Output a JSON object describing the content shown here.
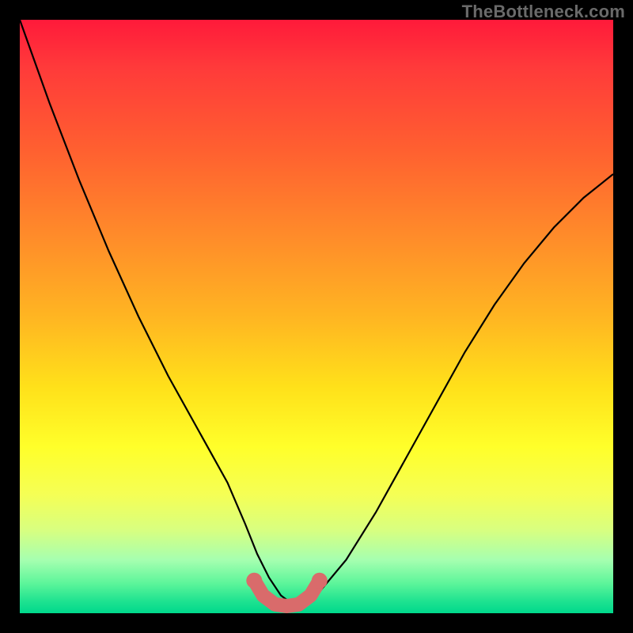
{
  "watermark": "TheBottleneck.com",
  "colors": {
    "background": "#000000",
    "curve_stroke": "#000000",
    "marker_stroke": "#d96b6b",
    "marker_fill": "#d96b6b",
    "gradient_top": "#ff1a3a",
    "gradient_bottom": "#00d88c"
  },
  "chart_data": {
    "type": "line",
    "title": "",
    "xlabel": "",
    "ylabel": "",
    "xlim": [
      0,
      100
    ],
    "ylim": [
      0,
      100
    ],
    "grid": false,
    "legend": false,
    "series": [
      {
        "name": "bottleneck-curve",
        "x": [
          0,
          5,
          10,
          15,
          20,
          25,
          30,
          35,
          38,
          40,
          42,
          44,
          46,
          48,
          50,
          55,
          60,
          65,
          70,
          75,
          80,
          85,
          90,
          95,
          100
        ],
        "y": [
          100,
          86,
          73,
          61,
          50,
          40,
          31,
          22,
          15,
          10,
          6,
          3,
          1.5,
          1.5,
          3,
          9,
          17,
          26,
          35,
          44,
          52,
          59,
          65,
          70,
          74
        ]
      },
      {
        "name": "bottom-markers",
        "x": [
          39.5,
          41,
          43,
          45,
          47,
          49,
          50.5
        ],
        "y": [
          5.5,
          3,
          1.5,
          1.2,
          1.5,
          3,
          5.5
        ]
      }
    ],
    "annotations": []
  }
}
